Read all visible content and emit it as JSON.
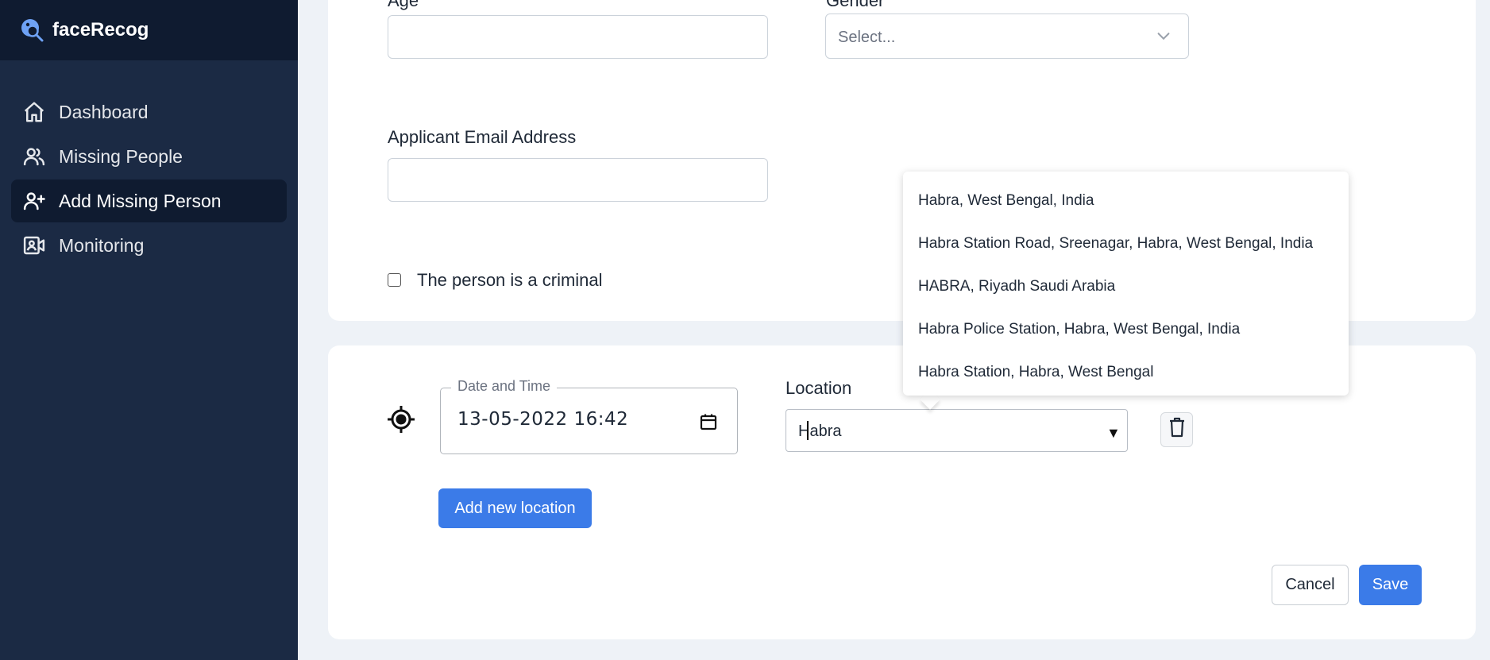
{
  "app": {
    "name": "faceRecog"
  },
  "sidebar": {
    "items": [
      {
        "label": "Dashboard",
        "icon": "home-icon"
      },
      {
        "label": "Missing People",
        "icon": "users-icon"
      },
      {
        "label": "Add Missing Person",
        "icon": "user-plus-icon",
        "active": true
      },
      {
        "label": "Monitoring",
        "icon": "video-camera-icon"
      }
    ]
  },
  "form": {
    "age_label": "Age",
    "gender_label": "Gender",
    "gender_placeholder": "Select...",
    "email_label": "Applicant Email Address",
    "email_value": "",
    "criminal_label": "The person is a criminal",
    "criminal_checked": false
  },
  "location_entry": {
    "datetime_label": "Date and Time",
    "datetime_value": "13-05-2022  16:42",
    "location_label": "Location",
    "location_value": "Habra",
    "suggestions": [
      "Habra, West Bengal, India",
      "Habra Station Road, Sreenagar, Habra, West Bengal, India",
      "HABRA, Riyadh Saudi Arabia",
      "Habra Police Station, Habra, West Bengal, India",
      "Habra Station, Habra, West Bengal"
    ],
    "add_location_label": "Add new location"
  },
  "actions": {
    "cancel_label": "Cancel",
    "save_label": "Save"
  },
  "colors": {
    "sidebar": "#1b2a44",
    "brand_bar": "#0f1b30",
    "primary": "#3b7be8",
    "page_bg": "#eef2f7"
  }
}
